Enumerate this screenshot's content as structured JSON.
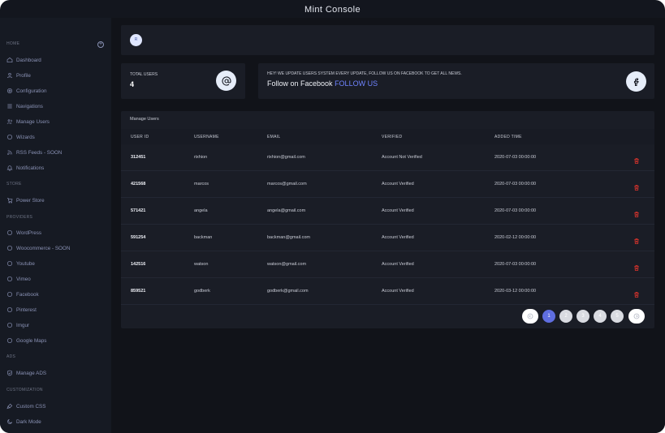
{
  "app": {
    "title": "Mint Console"
  },
  "sidebar": {
    "sections": [
      {
        "heading": "HOME",
        "items": [
          {
            "label": "Dashboard",
            "icon": "home-icon"
          },
          {
            "label": "Profile",
            "icon": "user-icon"
          },
          {
            "label": "Configuration",
            "icon": "gear-icon"
          },
          {
            "label": "Navigations",
            "icon": "menu-icon"
          },
          {
            "label": "Manage Users",
            "icon": "users-icon"
          },
          {
            "label": "Wizards",
            "icon": "circle-icon"
          },
          {
            "label": "RSS Feeds - SOON",
            "icon": "rss-icon"
          },
          {
            "label": "Notifications",
            "icon": "bell-icon"
          }
        ]
      },
      {
        "heading": "STORE",
        "items": [
          {
            "label": "Power Store",
            "icon": "cart-icon"
          }
        ]
      },
      {
        "heading": "PROVIDERS",
        "items": [
          {
            "label": "WordPress",
            "icon": "circle-icon"
          },
          {
            "label": "Woocommerce - SOON",
            "icon": "circle-icon"
          },
          {
            "label": "Youtube",
            "icon": "circle-icon"
          },
          {
            "label": "Vimeo",
            "icon": "circle-icon"
          },
          {
            "label": "Facebook",
            "icon": "circle-icon"
          },
          {
            "label": "Pinterest",
            "icon": "circle-icon"
          },
          {
            "label": "Imgur",
            "icon": "circle-icon"
          },
          {
            "label": "Google Maps",
            "icon": "circle-icon"
          }
        ]
      },
      {
        "heading": "ADS",
        "items": [
          {
            "label": "Manage ADS",
            "icon": "shield-icon"
          }
        ]
      },
      {
        "heading": "CUSTOMIZATION",
        "items": [
          {
            "label": "Custom CSS",
            "icon": "brush-icon"
          },
          {
            "label": "Dark Mode",
            "icon": "moon-icon"
          }
        ]
      }
    ]
  },
  "header": {
    "avatar_text": "R"
  },
  "stats": {
    "total_users_label": "TOTAL USERS",
    "total_users_value": "4",
    "icon": "at-icon"
  },
  "news": {
    "text": "HEY! WE UPDATE USERS SYSTEM EVERY UPDATE, FOLLOW US ON FACEBOOK TO GET ALL NEWS.",
    "follow_text": "Follow on Facebook",
    "follow_link": "FOLLOW US",
    "icon": "facebook-icon"
  },
  "users_table": {
    "title": "Manage Users",
    "columns": [
      "USER ID",
      "USERNAME",
      "EMAIL",
      "VERIFIED",
      "ADDED TIME"
    ],
    "rows": [
      {
        "id": "312451",
        "username": "rixhion",
        "email": "rixhion@gmail.com",
        "verified": "Account Not Verified",
        "added": "2020-07-03 00:00:00"
      },
      {
        "id": "421568",
        "username": "marcos",
        "email": "marcos@gmail.com",
        "verified": "Account Verified",
        "added": "2020-07-03 00:00:00"
      },
      {
        "id": "571421",
        "username": "angela",
        "email": "angela@gmail.com",
        "verified": "Account Verified",
        "added": "2020-07-03 00:00:00"
      },
      {
        "id": "591254",
        "username": "backman",
        "email": "backman@gmail.com",
        "verified": "Account Verified",
        "added": "2020-02-12 00:00:00"
      },
      {
        "id": "142516",
        "username": "watson",
        "email": "watson@gmail.com",
        "verified": "Account Verified",
        "added": "2020-07-03 00:00:00"
      },
      {
        "id": "859521",
        "username": "godberk",
        "email": "godberk@gmail.com",
        "verified": "Account Verified",
        "added": "2020-03-12 00:00:00"
      }
    ],
    "delete_icon": "trash-icon",
    "delete_color": "#e0342d"
  },
  "pagination": {
    "pages": [
      "1",
      "2",
      "3",
      "4",
      "5"
    ],
    "active_page": "1"
  },
  "colors": {
    "accent": "#6f84ff",
    "background": "#111319",
    "sidebar": "#161a23",
    "card": "#1a1d26"
  }
}
